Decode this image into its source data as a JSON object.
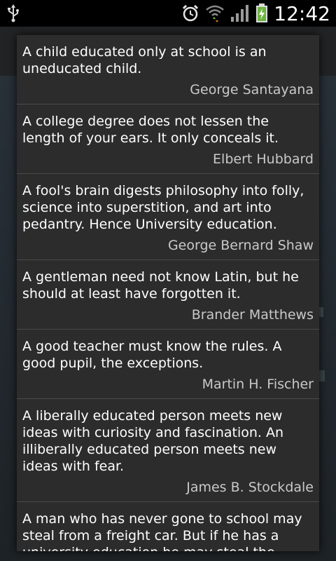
{
  "status_bar": {
    "time": "12:42",
    "icons": [
      "usb-icon",
      "alarm-icon",
      "wifi-icon",
      "signal-icon",
      "battery-charging-icon"
    ]
  },
  "quotes": [
    {
      "text": "A child educated only at school is an uneducated child.",
      "author": "George Santayana"
    },
    {
      "text": "A college degree does not lessen the length of your ears. It only conceals it.",
      "author": "Elbert Hubbard"
    },
    {
      "text": "A fool's brain digests philosophy into folly, science into superstition, and art into pedantry. Hence University education.",
      "author": "George Bernard Shaw"
    },
    {
      "text": "A gentleman need not know Latin, but he should at least have forgotten it.",
      "author": "Brander Matthews"
    },
    {
      "text": "A good teacher must know the rules. A good pupil, the exceptions.",
      "author": "Martin H. Fischer"
    },
    {
      "text": "A liberally educated person meets new ideas with curiosity and fascination. An illiberally educated person meets new ideas with fear.",
      "author": "James B. Stockdale"
    },
    {
      "text": "A man who has never gone to school may steal from a freight car. But if he has a university education he may steal the whole",
      "author": ""
    }
  ]
}
